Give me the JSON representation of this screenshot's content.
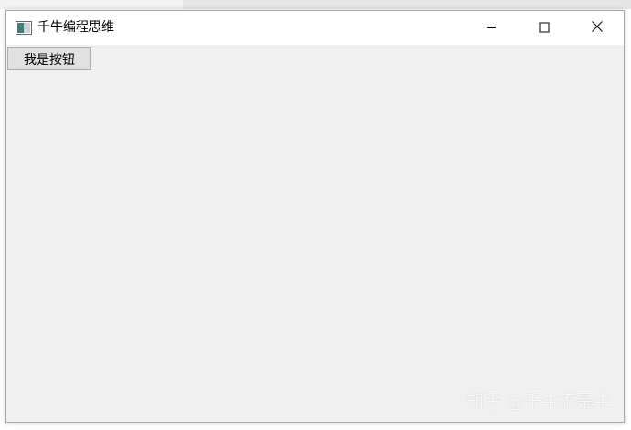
{
  "window": {
    "title": "千牛编程思维",
    "icons": {
      "app": "app-window-icon",
      "minimize": "minimize-icon",
      "maximize": "maximize-icon",
      "close": "close-icon"
    }
  },
  "content": {
    "button_label": "我是按钮"
  },
  "watermark": {
    "text": "知乎 @千牛不是牛"
  },
  "colors": {
    "window_bg": "#f0f0f0",
    "titlebar_bg": "#ffffff",
    "button_bg": "#e1e1e1",
    "button_border": "#adadad"
  }
}
